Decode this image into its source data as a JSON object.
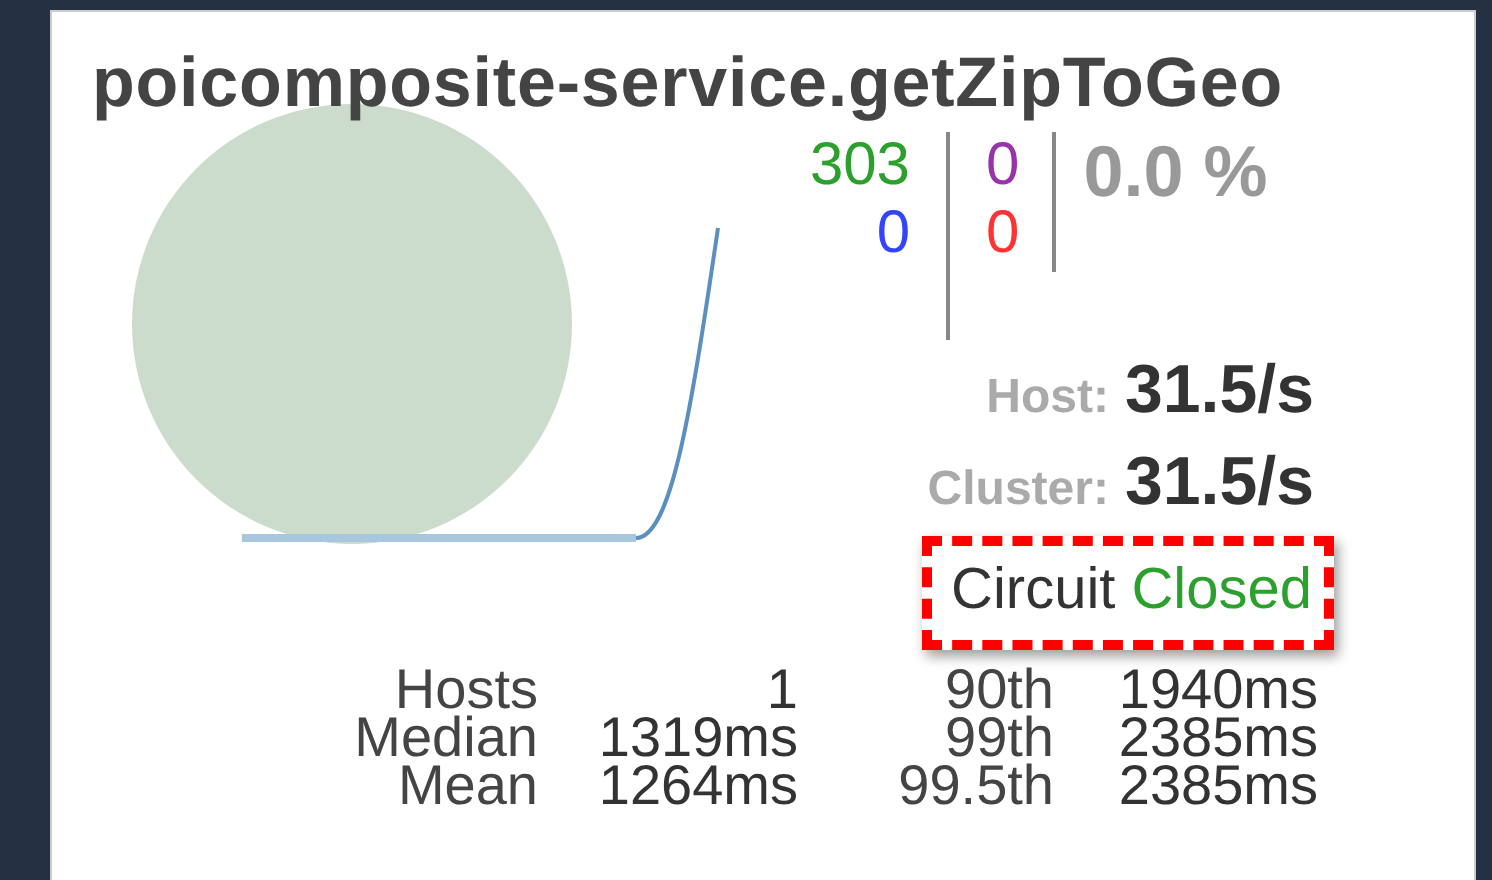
{
  "title": "poicomposite-service.getZipToGeo",
  "counts": [
    {
      "value": "303",
      "color": "#2ca02c"
    },
    {
      "value": "0",
      "color": "#9933aa"
    },
    {
      "value": "0",
      "color": "#3344ff"
    },
    {
      "value": "0",
      "color": "#ff3333"
    }
  ],
  "error_rate": "0.0 %",
  "rates": [
    {
      "label": "Host:",
      "value": "31.5/s"
    },
    {
      "label": "Cluster:",
      "value": "31.5/s"
    }
  ],
  "circuit": {
    "label": "Circuit",
    "status": "Closed",
    "color": "#2ca02c",
    "highlighted": true
  },
  "stats": [
    [
      "Hosts",
      "1",
      "90th",
      "1940ms"
    ],
    [
      "Median",
      "1319ms",
      "99th",
      "2385ms"
    ],
    [
      "Mean",
      "1264ms",
      "99.5th",
      "2385ms"
    ]
  ]
}
